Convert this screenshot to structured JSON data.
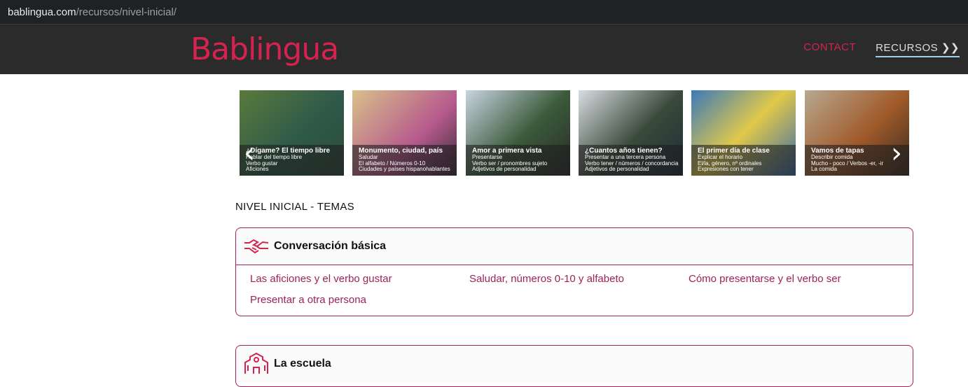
{
  "browser": {
    "host": "bablingua.com",
    "path": "/recursos/nivel-inicial/"
  },
  "nav": {
    "logo": "Bablingua",
    "contact": "CONTACT",
    "recursos": "RECURSOS ❯❯"
  },
  "carousel": [
    {
      "title": "¿Dígame? El tiempo libre",
      "lines": [
        "Hablar del tiempo libre",
        "Verbo gustar",
        "Aficiones"
      ],
      "bg": "linear-gradient(135deg,#5a7a3a,#2f5a4a 55%,#2c4a3a)"
    },
    {
      "title": "Monumento, ciudad, país",
      "lines": [
        "Saludar",
        "El alfabeto / Números 0-10",
        "Ciudades y países hispanohablantes"
      ],
      "bg": "linear-gradient(135deg,#d8c08a,#b65a8c 60%,#3a2a3a)"
    },
    {
      "title": "Amor a primera vista",
      "lines": [
        "Presentarse",
        "Verbo ser / pronombres sujeto",
        "Adjetivos de personalidad"
      ],
      "bg": "linear-gradient(135deg,#c8d4e0,#3a5a3a 55%,#2a2a2a)"
    },
    {
      "title": "¿Cuantos años tienen?",
      "lines": [
        "Presentar a una tercera persona",
        "Verbo tener / números / concordancia",
        "Adjetivos de personalidad"
      ],
      "bg": "linear-gradient(135deg,#d8dde2,#3a4a3a 55%,#1e2a3a)"
    },
    {
      "title": "El primer día de clase",
      "lines": [
        "Explicar el horario",
        "El/la, género, nº ordinales",
        "Expresiones con tener"
      ],
      "bg": "linear-gradient(135deg,#3a7ab8,#e0c84a 50%,#3a6aa8)"
    },
    {
      "title": "Vamos de tapas",
      "lines": [
        "Describir comida",
        "Mucho - poco / Verbos -er, -ir",
        "La comida"
      ],
      "bg": "linear-gradient(135deg,#b8a890,#a05a2a 55%,#3a2a20)"
    }
  ],
  "section_title": "NIVEL INICIAL - TEMAS",
  "cards": [
    {
      "title": "Conversación básica",
      "links": [
        "Las aficiones y el verbo gustar",
        "Saludar, números 0-10 y alfabeto",
        "Cómo presentarse y el verbo ser",
        "Presentar a otra persona"
      ]
    },
    {
      "title": "La escuela"
    }
  ]
}
